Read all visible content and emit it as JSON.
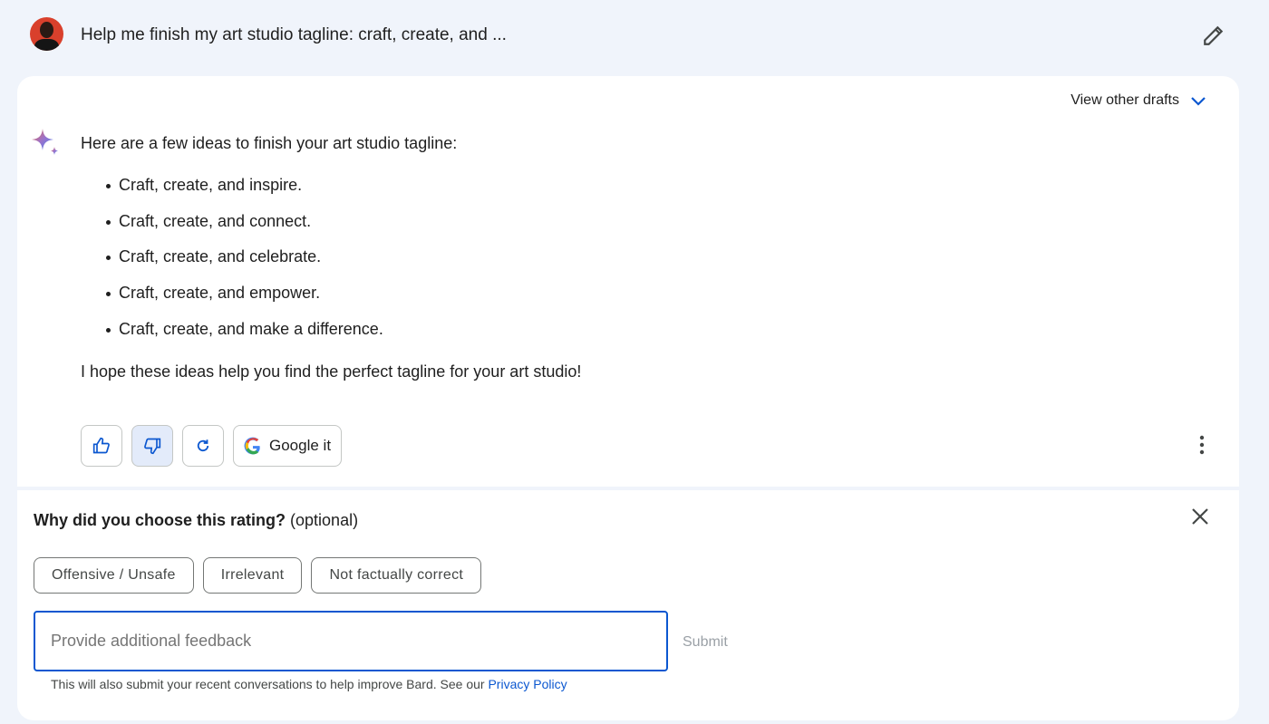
{
  "header": {
    "prompt": "Help me finish my art studio tagline: craft, create, and ..."
  },
  "response": {
    "view_drafts": "View other drafts",
    "intro": "Here are a few ideas to finish your art studio tagline:",
    "items": [
      "Craft, create, and inspire.",
      "Craft, create, and connect.",
      "Craft, create, and celebrate.",
      "Craft, create, and empower.",
      "Craft, create, and make a difference."
    ],
    "outro": "I hope these ideas help you find the perfect tagline for your art studio!",
    "google_it": "Google it"
  },
  "feedback": {
    "question": "Why did you choose this rating?",
    "optional": "(optional)",
    "chips": [
      "Offensive / Unsafe",
      "Irrelevant",
      "Not factually correct"
    ],
    "placeholder": "Provide additional feedback",
    "submit": "Submit",
    "note": "This will also submit your recent conversations to help improve Bard. See our ",
    "privacy": "Privacy Policy"
  },
  "colors": {
    "accent": "#0b57d0",
    "background": "#f0f4fb",
    "selected": "#e3ebfa"
  }
}
